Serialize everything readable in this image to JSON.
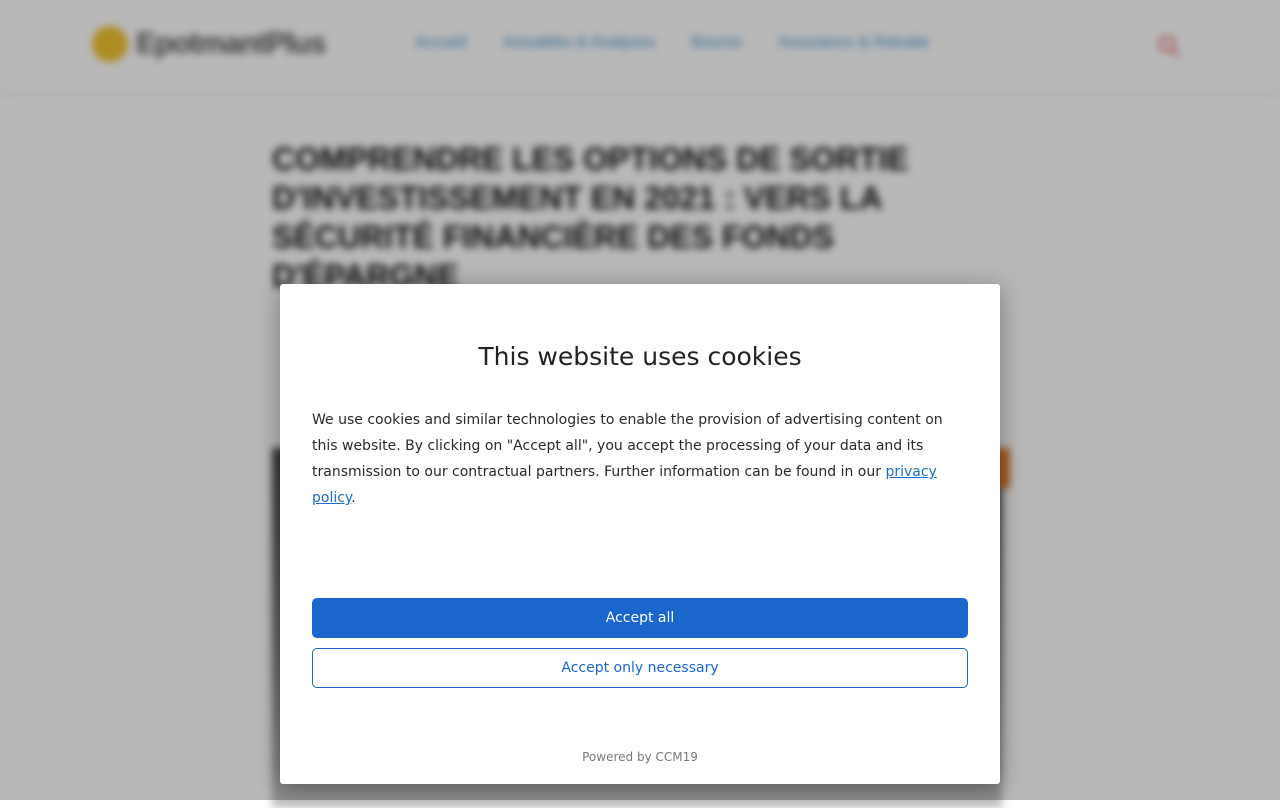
{
  "site": {
    "logo_text": "EpotmantPlus",
    "nav": [
      "Accueil",
      "Actualités & Analyses",
      "Bourse",
      "Assurance & Retraite"
    ],
    "article_title": "Comprendre les options de sortie d'investissement en 2021 : vers la sécurité financière des fonds d'épargne"
  },
  "cookie_dialog": {
    "title": "This website uses cookies",
    "body_text": "We use cookies and similar technologies to enable the provision of advertising content on this website. By clicking on \"Accept all\", you accept the processing of your data and its transmission to our contractual partners. Further information can be found in our ",
    "privacy_link": "privacy policy",
    "body_end": ".",
    "accept_all": "Accept all",
    "accept_necessary": "Accept only necessary",
    "powered_by": "Powered by CCM19"
  },
  "colors": {
    "primary": "#1a66cc",
    "link": "#1a6fc4",
    "logo_accent": "#f2c230",
    "nav_link": "#3d8fd0"
  },
  "icons": {
    "search": "search-icon",
    "logo": "logo-mark-icon"
  }
}
